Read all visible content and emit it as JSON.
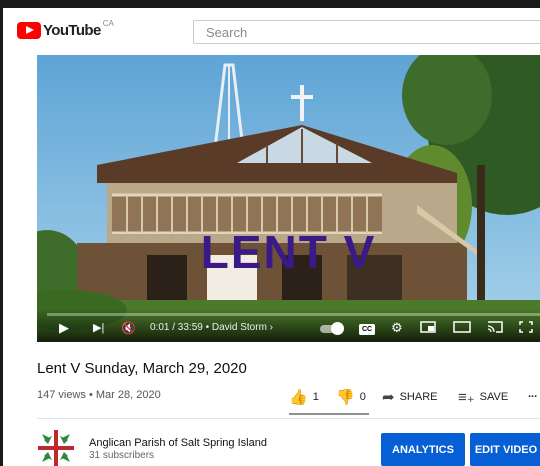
{
  "header": {
    "logo_text": "YouTube",
    "region": "CA",
    "search_placeholder": "Search"
  },
  "player": {
    "overlay_text": "LENT V",
    "time": "0:01 / 33:59 • David Storm ›",
    "cc_label": "CC",
    "progress_fraction": 0.0005
  },
  "video": {
    "title": "Lent V Sunday, March 29, 2020",
    "meta": "147 views • Mar 28, 2020",
    "likes": "1",
    "dislikes": "0",
    "share_label": "SHARE",
    "save_label": "SAVE",
    "more_label": "..."
  },
  "channel": {
    "name": "Anglican Parish of Salt Spring Island",
    "subscribers": "31 subscribers"
  },
  "buttons": {
    "analytics": "ANALYTICS",
    "edit_video": "EDIT VIDEO"
  },
  "colors": {
    "brand_red": "#ff0000",
    "button_blue": "#065fd4",
    "overlay_purple": "#3a1a86"
  }
}
